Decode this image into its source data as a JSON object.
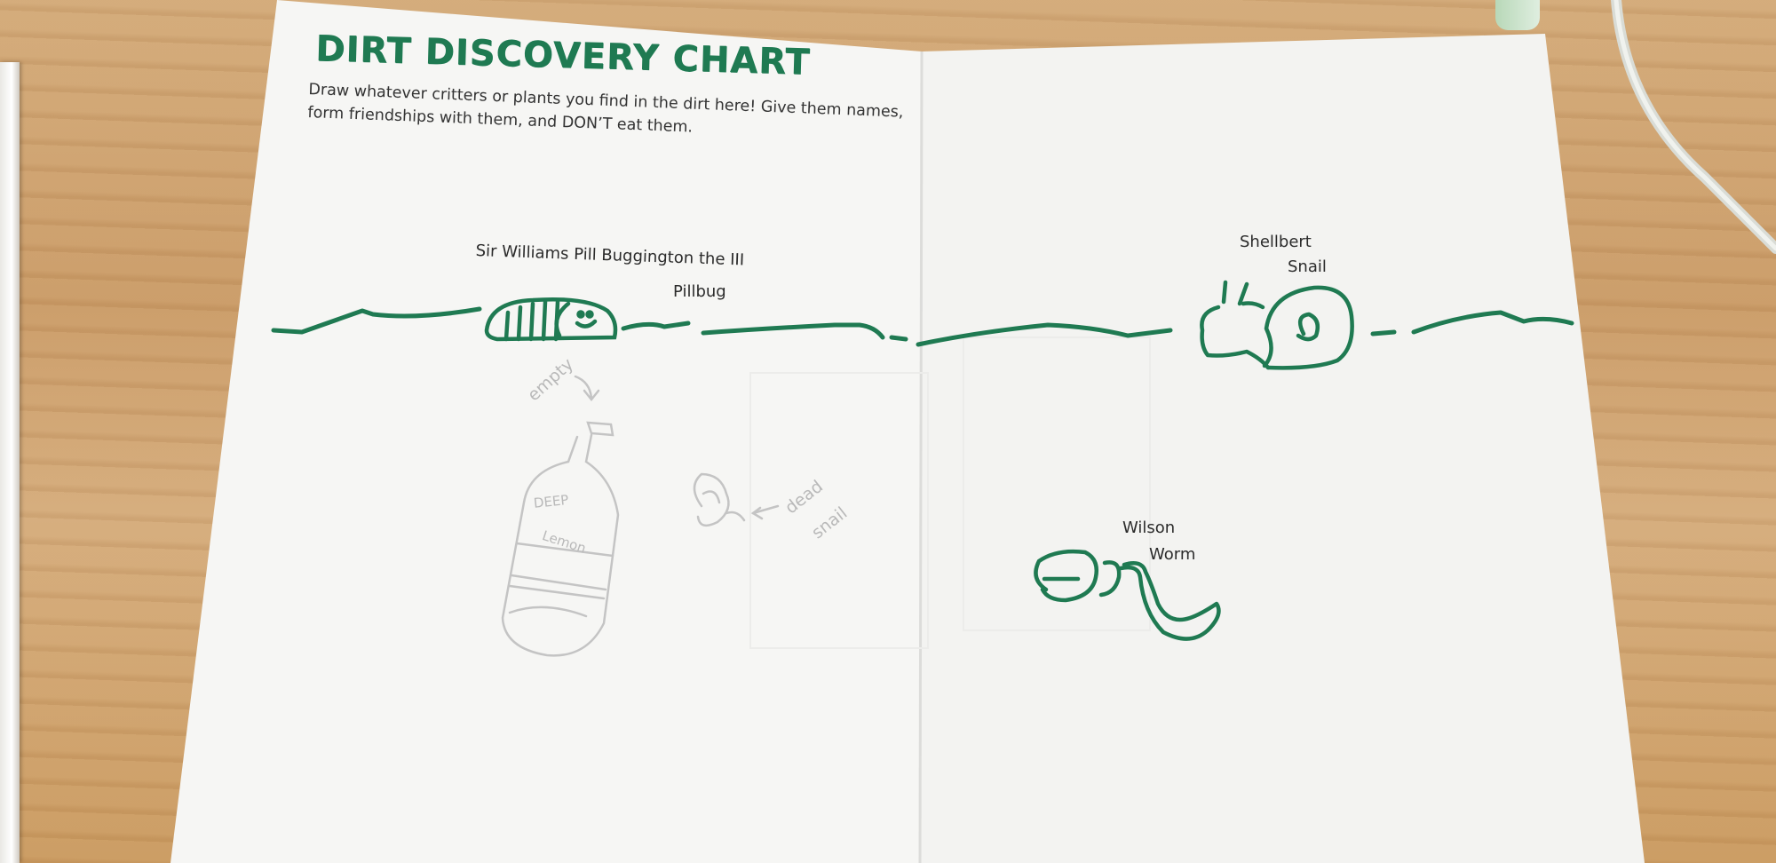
{
  "chart": {
    "title": "DIRT DISCOVERY CHART",
    "instructions": "Draw whatever critters or plants you find in the dirt here! Give them names, form friendships with them, and DON’T eat them."
  },
  "critters": {
    "pillbug_name": "Sir Williams Pill Buggington the III",
    "pillbug_species": "Pillbug",
    "snail_name": "Shellbert",
    "snail_species": "Snail",
    "worm_name": "Wilson",
    "worm_species": "Worm"
  },
  "pencil_notes": {
    "empty": "empty",
    "bottle_label_1": "DEEP",
    "bottle_label_2": "Lemon",
    "dead": "dead",
    "snail": "snail"
  },
  "colors": {
    "ink_green": "#1f7a52",
    "pencil_gray": "#bdbdbd",
    "paper": "#f7f7f5"
  }
}
